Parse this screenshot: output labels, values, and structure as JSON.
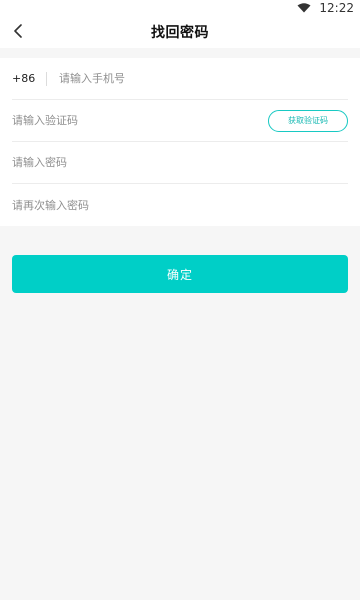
{
  "status_bar": {
    "time": "12:22"
  },
  "header": {
    "title": "找回密码",
    "back_icon": "chevron-left-icon"
  },
  "form": {
    "country_code": "+86",
    "phone_placeholder": "请输入手机号",
    "verify_code_placeholder": "请输入验证码",
    "get_code_label": "获取验证码",
    "password_placeholder": "请输入密码",
    "confirm_password_placeholder": "请再次输入密码"
  },
  "actions": {
    "confirm_label": "确定"
  },
  "colors": {
    "accent": "#00cfc7",
    "background": "#f6f6f6"
  }
}
